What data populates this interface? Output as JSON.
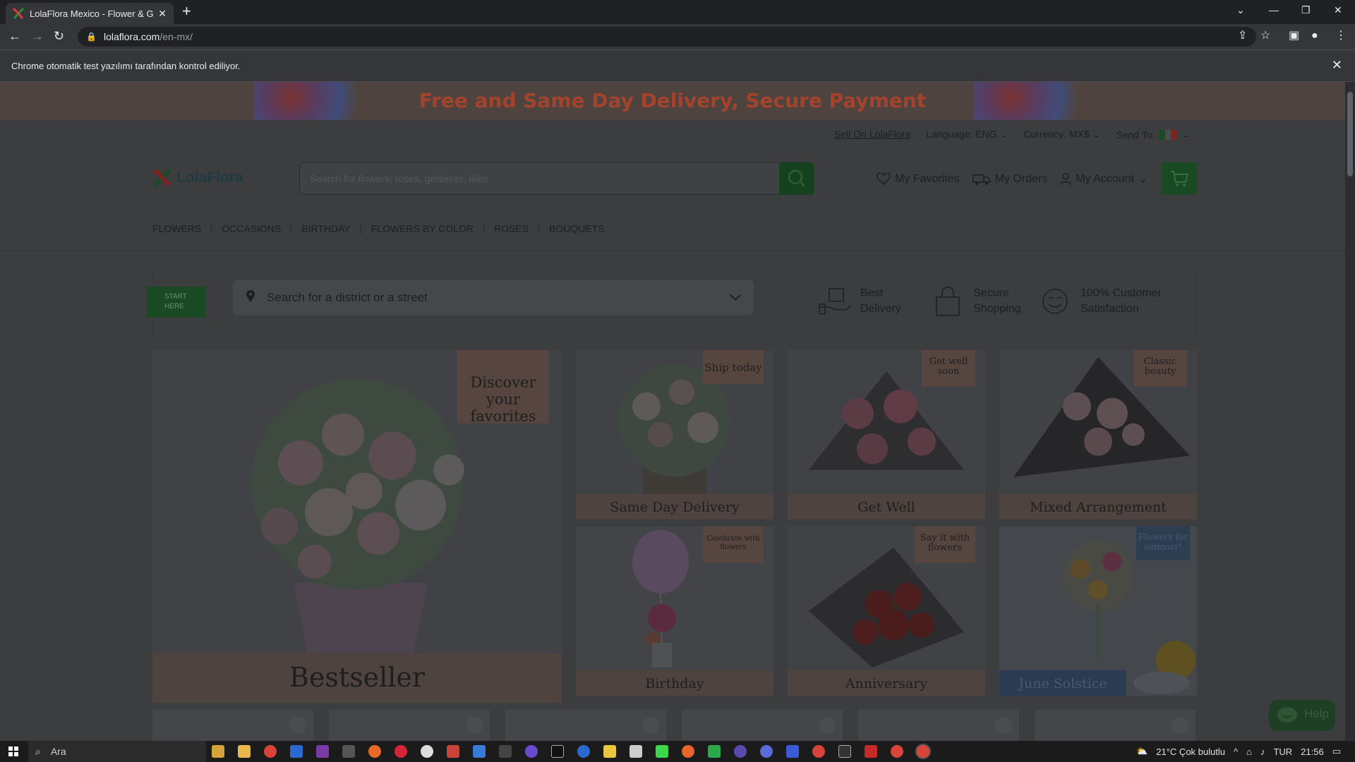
{
  "browser": {
    "tab_title": "LolaFlora Mexico - Flower & Gift",
    "url_host": "lolaflora.com",
    "url_path": "/en-mx/",
    "infobar_message": "Chrome otomatik test yazılımı tarafından kontrol ediliyor."
  },
  "promo": {
    "text": "Free and Same Day Delivery, Secure Payment"
  },
  "utility": {
    "sell": "Sell On LolaFlora",
    "language": "Language: ENG",
    "currency": "Currency: MX$",
    "send_to": "Send To:"
  },
  "header": {
    "logo": "LolaFlora",
    "search_placeholder": "Search for flowers: roses, gerberas, lilies",
    "favorites": "My Favorites",
    "orders": "My Orders",
    "account": "My Account"
  },
  "nav": [
    "FLOWERS",
    "OCCASIONS",
    "BIRTHDAY",
    "FLOWERS BY COLOR",
    "ROSES",
    "BOUQUETS"
  ],
  "delivery": {
    "start_line1": "START",
    "start_line2": "HERE",
    "district_placeholder": "Search for a district or a street",
    "features": [
      {
        "line1": "Best",
        "line2": "Delivery",
        "icon": "delivery-hand-icon"
      },
      {
        "line1": "Secure",
        "line2": "Shopping",
        "icon": "shopping-bag-icon"
      },
      {
        "line1": "100% Customer",
        "line2": "Satisfaction",
        "icon": "smiley-icon"
      }
    ]
  },
  "categories": {
    "featured": {
      "label": "Bestseller",
      "tag": "Discover your favorites"
    },
    "cards": [
      {
        "label": "Same Day Delivery",
        "tag": "Ship today"
      },
      {
        "label": "Get Well",
        "tag": "Get well soon"
      },
      {
        "label": "Mixed Arrangement",
        "tag": "Classic beauty"
      },
      {
        "label": "Birthday",
        "tag": "Celebrate with flowers"
      },
      {
        "label": "Anniversary",
        "tag": "Say it with flowers"
      },
      {
        "label": "June Solstice",
        "tag": "Flowers for summer!"
      }
    ]
  },
  "help": "Help",
  "taskbar": {
    "search": "Ara",
    "weather": "21°C  Çok bulutlu",
    "lang": "TUR",
    "time": "21:56"
  }
}
